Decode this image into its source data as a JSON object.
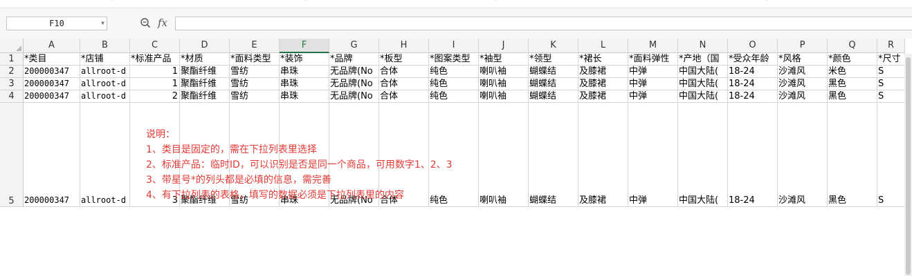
{
  "ribbon": {
    "marks": [
      "ˇ",
      "ˇ",
      "ˇ",
      "ˇ"
    ]
  },
  "formula_bar": {
    "name_box": "F10",
    "fx_label": "fx",
    "formula": ""
  },
  "columns": [
    "A",
    "B",
    "C",
    "D",
    "E",
    "F",
    "G",
    "H",
    "I",
    "J",
    "K",
    "L",
    "M",
    "N",
    "O",
    "P",
    "Q",
    "R"
  ],
  "active_column": "F",
  "rows": [
    {
      "number": "1",
      "cells": [
        "*类目",
        "*店铺",
        "*标准产品",
        "*材质",
        "*面料类型",
        "*装饰",
        "*品牌",
        "*板型",
        "*图案类型",
        "*袖型",
        "*领型",
        "*裙长",
        "*面料弹性",
        "*产地（国",
        "*受众年龄",
        "*风格",
        "*颜色",
        "*尺寸"
      ]
    },
    {
      "number": "2",
      "cells": [
        "200000347",
        "allroot-d",
        "1",
        "聚酯纤维",
        "雪纺",
        "串珠",
        "无品牌(No",
        "合体",
        "纯色",
        "喇叭袖",
        "蝴蝶结",
        "及膝裙",
        "中弹",
        "中国大陆(",
        "18-24",
        "沙滩风",
        "米色",
        "S"
      ]
    },
    {
      "number": "3",
      "cells": [
        "200000347",
        "allroot-d",
        "1",
        "聚酯纤维",
        "雪纺",
        "串珠",
        "无品牌(No",
        "合体",
        "纯色",
        "喇叭袖",
        "蝴蝶结",
        "及膝裙",
        "中弹",
        "中国大陆(",
        "18-24",
        "沙滩风",
        "黑色",
        "S"
      ]
    },
    {
      "number": "4",
      "cells": [
        "200000347",
        "allroot-d",
        "2",
        "聚酯纤维",
        "雪纺",
        "串珠",
        "无品牌(No",
        "合体",
        "纯色",
        "喇叭袖",
        "蝴蝶结",
        "及膝裙",
        "中弹",
        "中国大陆(",
        "18-24",
        "沙滩风",
        "黑色",
        "S"
      ]
    },
    {
      "number": "5",
      "cells": [
        "200000347",
        "allroot-d",
        "3",
        "聚酯纤维",
        "雪纺",
        "串珠",
        "无品牌(No",
        "合体",
        "纯色",
        "喇叭袖",
        "蝴蝶结",
        "及膝裙",
        "中弹",
        "中国大陆(",
        "18-24",
        "沙滩风",
        "黑色",
        "S"
      ]
    }
  ],
  "note": {
    "color": "#e03b36",
    "lines": [
      "说明：",
      "1、类目是固定的，需在下拉列表里选择",
      "2、标准产品：临时ID，可以识别是否是同一个商品，可用数字1、2、3",
      "3、带星号*的列头都是必填的信息，需完善",
      "4、有下拉列表的表格，填写的数据必须是下拉列表里的内容"
    ]
  }
}
